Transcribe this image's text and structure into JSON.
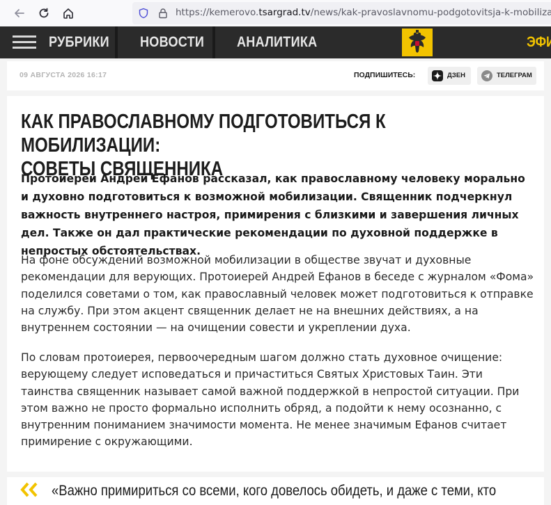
{
  "browser": {
    "url_prefix": "https://kemerovo.",
    "url_domain": "tsargrad.tv",
    "url_path": "/news/kak-pravoslavnomu-podgotovitsja-k-mobilizacii-sove"
  },
  "nav": {
    "items": [
      "РУБРИКИ",
      "НОВОСТИ",
      "АНАЛИТИКА"
    ],
    "efir": "ЭФИ",
    "accent": "#f2c300"
  },
  "meta": {
    "date": "09 АВГУСТА 2026 16:17",
    "subscribe_label": "ПОДПИШИТЕСЬ:",
    "dzen": "ДЗЕН",
    "telegram": "ТЕЛЕГРАМ"
  },
  "article": {
    "title_line1": "КАК ПРАВОСЛАВНОМУ ПОДГОТОВИТЬСЯ К МОБИЛИЗАЦИИ:",
    "title_line2": "СОВЕТЫ СВЯЩЕННИКА",
    "lead": "Протоиерей Андрей Ефанов рассказал, как православному человеку морально и духовно подготовиться к возможной мобилизации. Священник подчеркнул важность внутреннего настроя, примирения с близкими и завершения личных дел. Также он дал практические рекомендации по духовной поддержке в непростых обстоятельствах.",
    "paragraph1": "На фоне обсуждений возможной мобилизации в обществе звучат и духовные рекомендации для верующих. Протоиерей Андрей Ефанов в беседе с журналом «Фома» поделился советами о том, как православный человек может подготовиться к отправке на службу. При этом акцент священник делает не на внешних действиях, а на внутреннем состоянии — на очищении совести и укреплении духа.",
    "paragraph2": "По словам протоиерея, первоочередным шагом должно стать духовное очищение: верующему следует исповедаться и причаститься Святых Христовых Таин. Эти таинства священник называет самой важной поддержкой в непростой ситуации. При этом важно не просто формально исполнить обряд, а подойти к нему осознанно, с внутренним пониманием значимости момента. Не менее значимым Ефанов считает примирение с окружающими.",
    "quote": "«Важно примириться со всеми, кого довелось обидеть, и даже с теми, кто"
  },
  "icons": {
    "back": "arrow-left-icon",
    "reload": "reload-icon",
    "home": "home-icon",
    "shield": "shield-icon",
    "lock": "lock-icon",
    "dzen": "dzen-icon",
    "telegram": "telegram-icon",
    "quote": "quote-icon",
    "logo": "eagle-logo"
  }
}
